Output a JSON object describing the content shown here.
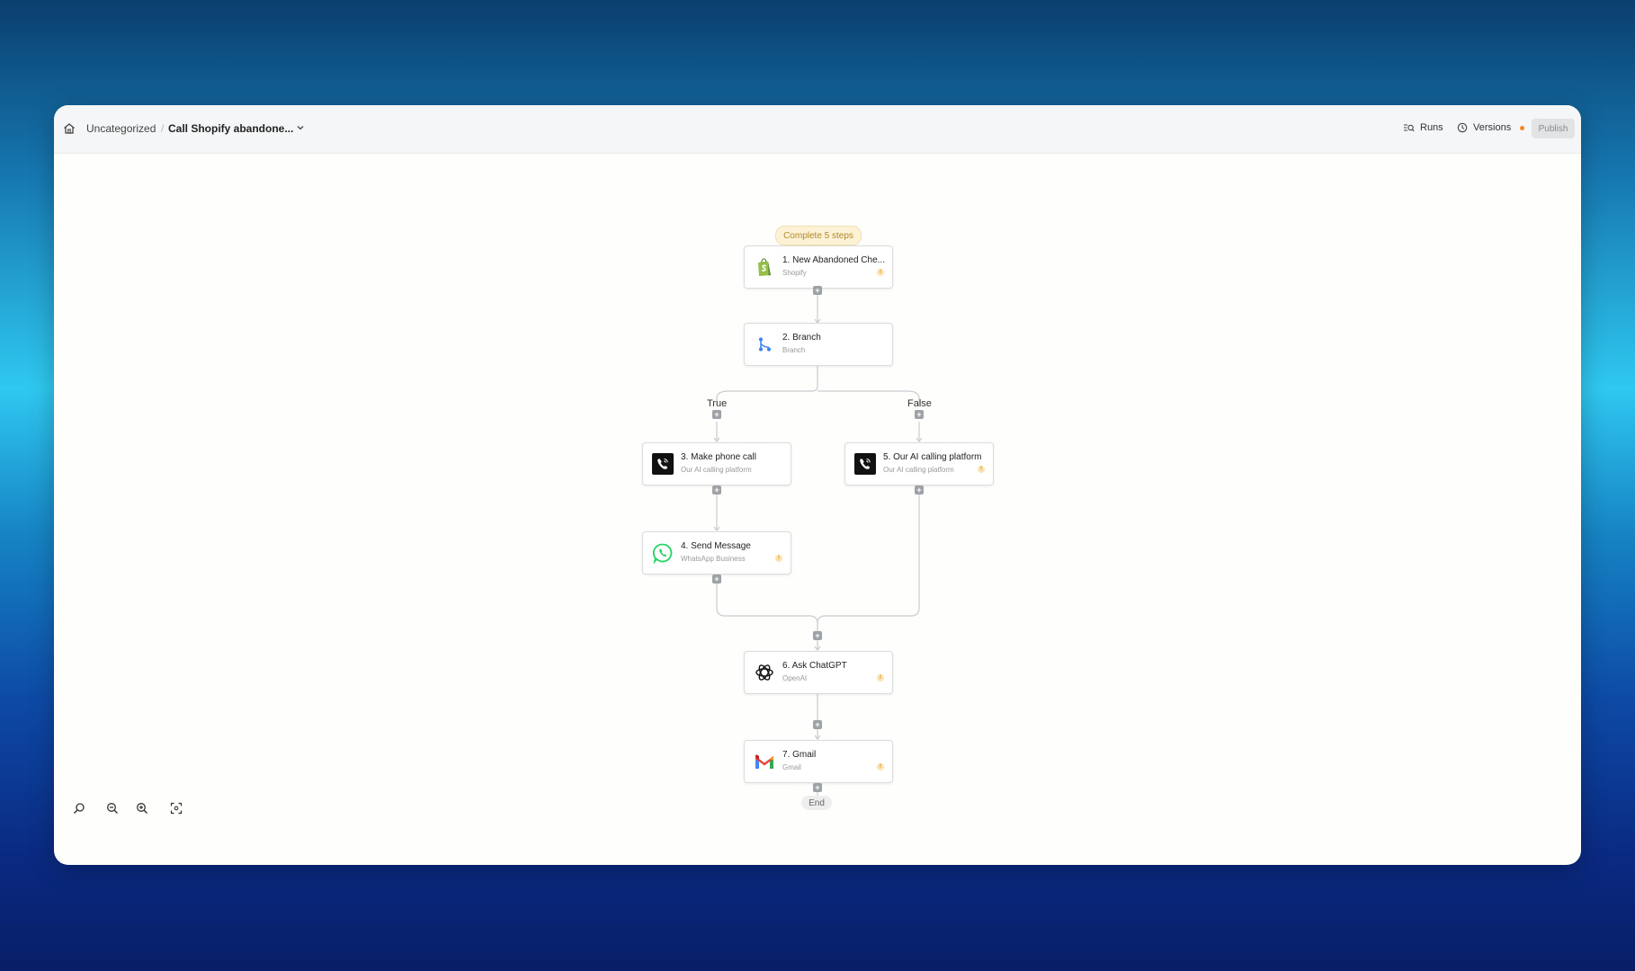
{
  "header": {
    "breadcrumb_category": "Uncategorized",
    "breadcrumb_separator": "/",
    "flow_title": "Call Shopify abandone...",
    "runs_label": "Runs",
    "versions_label": "Versions",
    "publish_label": "Publish"
  },
  "canvas": {
    "badge": "Complete 5 steps",
    "branch_true": "True",
    "branch_false": "False",
    "end_label": "End",
    "plus_glyph": "+",
    "warn_glyph": "!"
  },
  "steps": [
    {
      "title": "1. New Abandoned Che...",
      "app": "Shopify",
      "icon": "shopify-icon",
      "warning": true
    },
    {
      "title": "2. Branch",
      "app": "Branch",
      "icon": "branch-icon",
      "warning": false
    },
    {
      "title": "3. Make phone call",
      "app": "Our AI calling platform",
      "icon": "phone-icon",
      "warning": false
    },
    {
      "title": "4. Send Message",
      "app": "WhatsApp Business",
      "icon": "whatsapp-icon",
      "warning": true
    },
    {
      "title": "5. Our AI calling platform",
      "app": "Our AI calling platform",
      "icon": "phone-icon",
      "warning": true
    },
    {
      "title": "6. Ask ChatGPT",
      "app": "OpenAI",
      "icon": "openai-icon",
      "warning": true
    },
    {
      "title": "7. Gmail",
      "app": "Gmail",
      "icon": "gmail-icon",
      "warning": true
    }
  ],
  "zoom_controls": [
    "zoom-search-icon",
    "zoom-out-icon",
    "zoom-in-icon",
    "fit-screen-icon"
  ],
  "colors": {
    "warning": "#f08a28",
    "badge_text": "#b4882a",
    "shopify": "#95bf47",
    "whatsapp": "#25d366"
  }
}
